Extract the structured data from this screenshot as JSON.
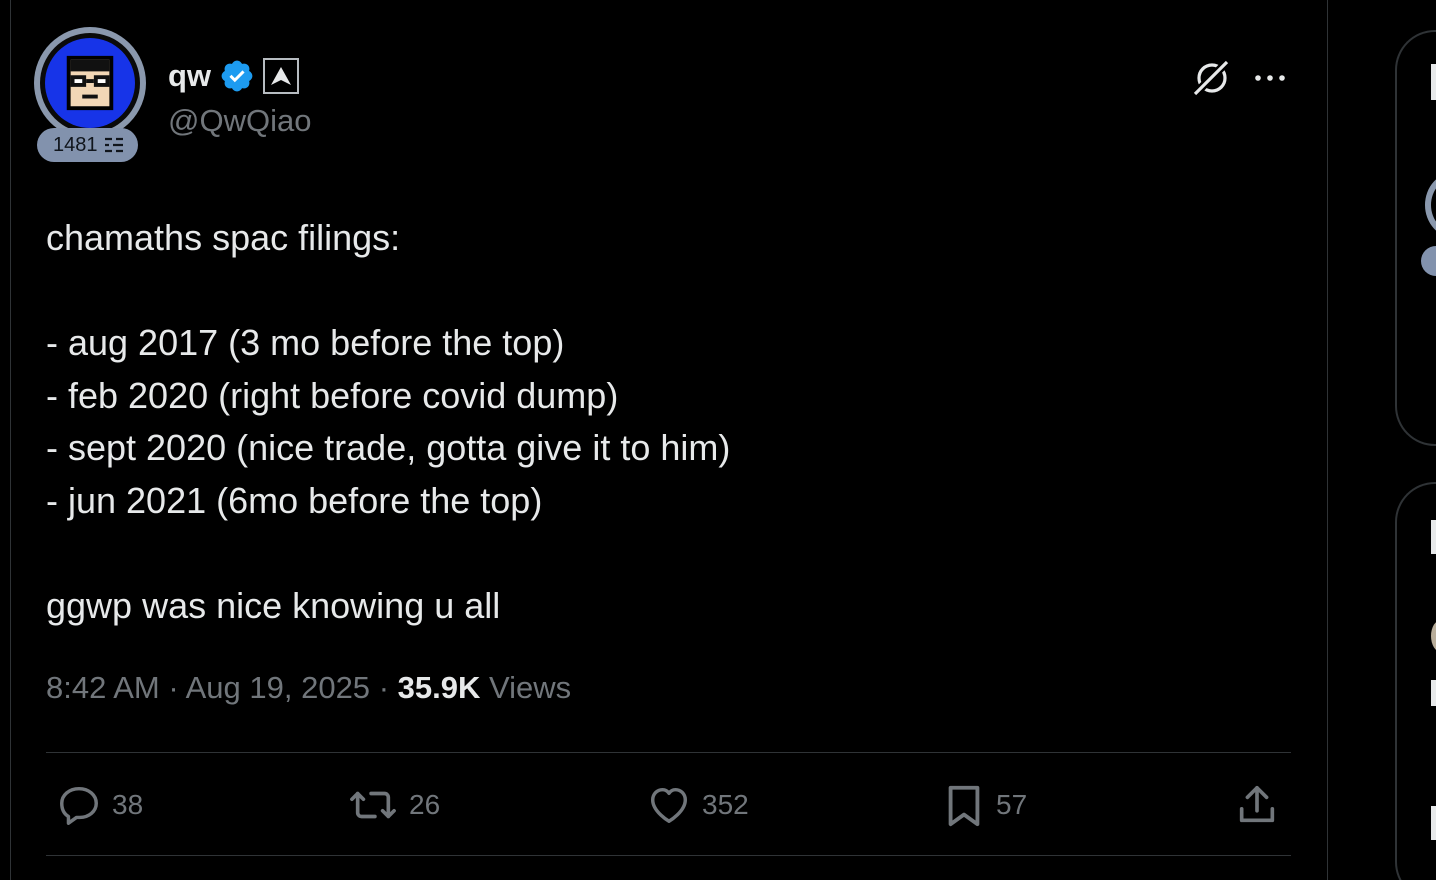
{
  "tweet": {
    "author": {
      "display_name": "qw",
      "handle": "@QwQiao",
      "level_badge": "1481",
      "verified": true,
      "verified_color": "#1d9bf0"
    },
    "text": "chamaths spac filings:\n\n- aug 2017 (3 mo before the top)\n- feb 2020 (right before covid dump)\n- sept 2020 (nice trade, gotta give it to him)\n- jun 2021 (6mo before the top)\n\nggwp was nice knowing u all",
    "time": "8:42 AM",
    "date": "Aug 19, 2025",
    "separator": "·",
    "views_count": "35.9K",
    "views_label": "Views",
    "actions": {
      "replies": "38",
      "reposts": "26",
      "likes": "352",
      "bookmarks": "57"
    }
  },
  "icons": {
    "verified": "verified-badge-icon",
    "affiliate": "affiliate-badge-icon",
    "grok": "grok-icon",
    "more": "more-options-icon",
    "reply": "reply-icon",
    "repost": "repost-icon",
    "like": "heart-icon",
    "bookmark": "bookmark-icon",
    "share": "share-icon"
  },
  "colors": {
    "background": "#000000",
    "text": "#e7e9ea",
    "muted": "#71767b",
    "border": "#2f3336",
    "accent": "#1d9bf0",
    "avatar_bg": "#1734e8"
  }
}
